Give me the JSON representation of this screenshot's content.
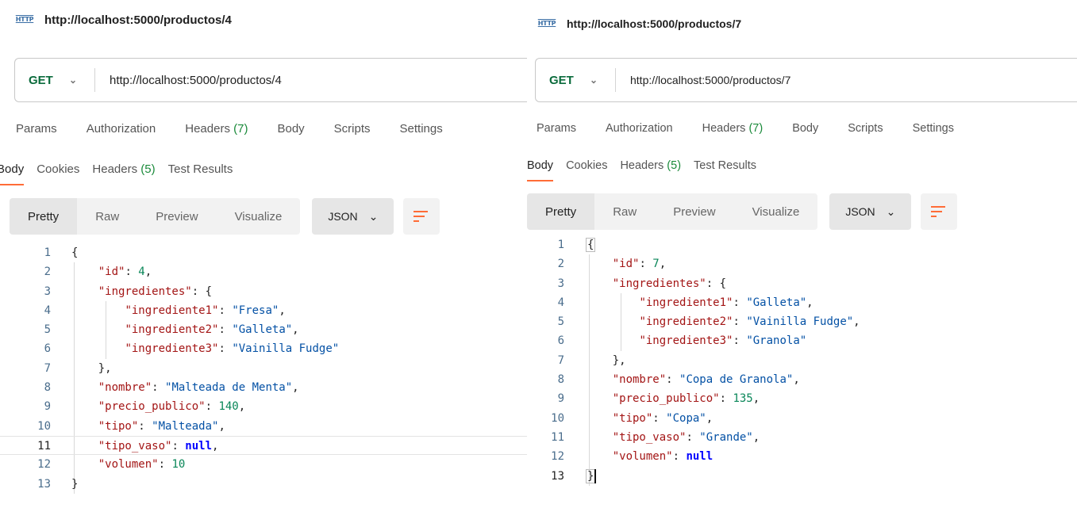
{
  "panes": [
    {
      "title": "http://localhost:5000/productos/4",
      "method": "GET",
      "url": "http://localhost:5000/productos/4",
      "request_tabs": [
        {
          "label": "Params",
          "count": ""
        },
        {
          "label": "Authorization",
          "count": ""
        },
        {
          "label": "Headers",
          "count": "(7)"
        },
        {
          "label": "Body",
          "count": ""
        },
        {
          "label": "Scripts",
          "count": ""
        },
        {
          "label": "Settings",
          "count": ""
        }
      ],
      "response_tabs": [
        {
          "label": "Body",
          "count": ""
        },
        {
          "label": "Cookies",
          "count": ""
        },
        {
          "label": "Headers",
          "count": "(5)"
        },
        {
          "label": "Test Results",
          "count": ""
        }
      ],
      "view_modes": [
        "Pretty",
        "Raw",
        "Preview",
        "Visualize"
      ],
      "format": "JSON",
      "line_numbers": [
        "1",
        "2",
        "3",
        "4",
        "5",
        "6",
        "7",
        "8",
        "9",
        "10",
        "11",
        "12",
        "13"
      ],
      "code": {
        "id_key": "\"id\"",
        "id_val": "4",
        "ing_key": "\"ingredientes\"",
        "ing1_key": "\"ingrediente1\"",
        "ing1_val": "\"Fresa\"",
        "ing2_key": "\"ingrediente2\"",
        "ing2_val": "\"Galleta\"",
        "ing3_key": "\"ingrediente3\"",
        "ing3_val": "\"Vainilla Fudge\"",
        "nombre_key": "\"nombre\"",
        "nombre_val": "\"Malteada de Menta\"",
        "precio_key": "\"precio_publico\"",
        "precio_val": "140",
        "tipo_key": "\"tipo\"",
        "tipo_val": "\"Malteada\"",
        "vaso_key": "\"tipo_vaso\"",
        "vaso_val": "null",
        "vol_key": "\"volumen\"",
        "vol_val": "10"
      }
    },
    {
      "title": "http://localhost:5000/productos/7",
      "method": "GET",
      "url": "http://localhost:5000/productos/7",
      "request_tabs": [
        {
          "label": "Params",
          "count": ""
        },
        {
          "label": "Authorization",
          "count": ""
        },
        {
          "label": "Headers",
          "count": "(7)"
        },
        {
          "label": "Body",
          "count": ""
        },
        {
          "label": "Scripts",
          "count": ""
        },
        {
          "label": "Settings",
          "count": ""
        }
      ],
      "response_tabs": [
        {
          "label": "Body",
          "count": ""
        },
        {
          "label": "Cookies",
          "count": ""
        },
        {
          "label": "Headers",
          "count": "(5)"
        },
        {
          "label": "Test Results",
          "count": ""
        }
      ],
      "view_modes": [
        "Pretty",
        "Raw",
        "Preview",
        "Visualize"
      ],
      "format": "JSON",
      "line_numbers": [
        "1",
        "2",
        "3",
        "4",
        "5",
        "6",
        "7",
        "8",
        "9",
        "10",
        "11",
        "12",
        "13"
      ],
      "code": {
        "id_key": "\"id\"",
        "id_val": "7",
        "ing_key": "\"ingredientes\"",
        "ing1_key": "\"ingrediente1\"",
        "ing1_val": "\"Galleta\"",
        "ing2_key": "\"ingrediente2\"",
        "ing2_val": "\"Vainilla Fudge\"",
        "ing3_key": "\"ingrediente3\"",
        "ing3_val": "\"Granola\"",
        "nombre_key": "\"nombre\"",
        "nombre_val": "\"Copa de Granola\"",
        "precio_key": "\"precio_publico\"",
        "precio_val": "135",
        "tipo_key": "\"tipo\"",
        "tipo_val": "\"Copa\"",
        "vaso_key": "\"tipo_vaso\"",
        "vaso_val": "\"Grande\"",
        "vol_key": "\"volumen\"",
        "vol_val": "null"
      }
    }
  ],
  "colors": {
    "accent": "#ff6c37",
    "method_get": "#0b6b3c",
    "json_key": "#a31515",
    "json_string": "#0451a5",
    "json_number": "#098658",
    "json_null": "#0000ff"
  },
  "icons": {
    "request_type": "http-icon",
    "method_dropdown": "chevron-down-icon",
    "format_dropdown": "chevron-down-icon",
    "wrap": "wrap-lines-icon"
  }
}
